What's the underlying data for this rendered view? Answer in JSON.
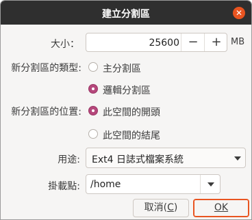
{
  "window": {
    "title": "建立分割區",
    "close_icon": "close-icon"
  },
  "size": {
    "label": "大小：",
    "value": "25600",
    "minus": "−",
    "plus": "+",
    "unit": "MB"
  },
  "type": {
    "label": "新分割區的類型:",
    "options": [
      {
        "label": "主分割區",
        "checked": false
      },
      {
        "label": "邏輯分割區",
        "checked": true
      }
    ]
  },
  "location": {
    "label": "新分割區的位置:",
    "options": [
      {
        "label": "此空間的開頭",
        "checked": true
      },
      {
        "label": "此空間的結尾",
        "checked": false
      }
    ]
  },
  "use_as": {
    "label": "用途:",
    "value": "Ext4 日誌式檔案系統"
  },
  "mount_point": {
    "label": "掛載點:",
    "value": "/home"
  },
  "buttons": {
    "cancel_prefix": "取消(",
    "cancel_mnemonic": "C",
    "cancel_suffix": ")",
    "ok": "OK"
  },
  "colors": {
    "titlebar": "#2f2f2f",
    "accent": "#e95420",
    "radio": "#b5477b"
  }
}
